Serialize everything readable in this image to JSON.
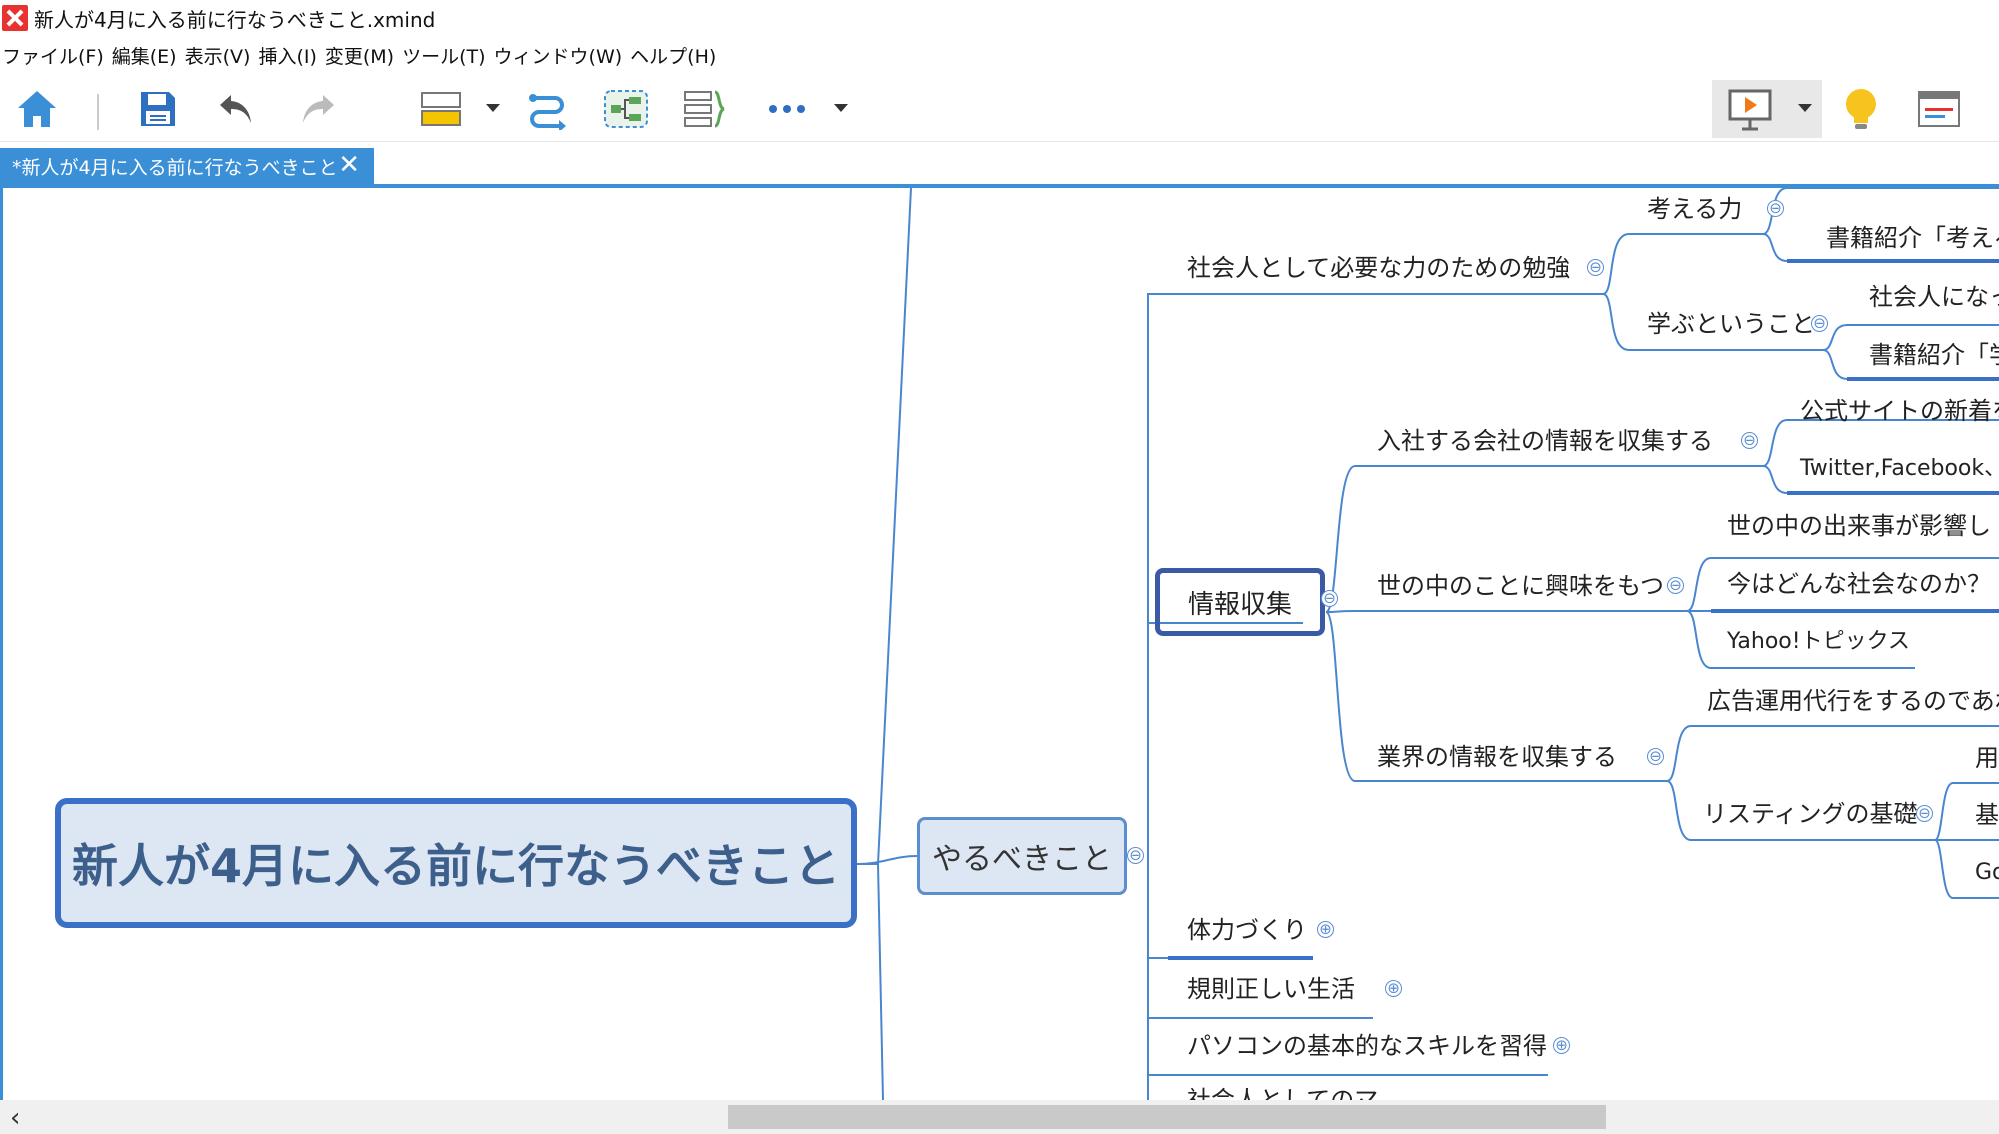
{
  "window": {
    "title": "新人が4月に入る前に行なうべきこと.xmind"
  },
  "menu": [
    "ファイル(F)",
    "編集(E)",
    "表示(V)",
    "挿入(I)",
    "変更(M)",
    "ツール(T)",
    "ウィンドウ(W)",
    "ヘルプ(H)"
  ],
  "toolbar": {
    "icons": [
      "home-icon",
      "save-icon",
      "undo-icon",
      "redo-icon",
      "topic-icon",
      "relationship-icon",
      "boundary-icon",
      "summary-icon",
      "more-icon",
      "presentation-icon",
      "idea-icon",
      "panel-icon"
    ],
    "accent": "#3a8fd6"
  },
  "tab": {
    "label": "*新人が4月に入る前に行なうべきこと",
    "close": "✕"
  },
  "mindmap": {
    "central": "新人が4月に入る前に行なうべきこと",
    "main_topic": "やるべきこと",
    "study": "社会人として必要な力のための勉強",
    "think": "考える力",
    "book_think": "書籍紹介「考える",
    "learn": "学ぶということ",
    "become": "社会人になっ",
    "book_learn": "書籍紹介「学",
    "info": "情報収集",
    "company": "入社する会社の情報を収集する",
    "official": "公式サイトの新着を",
    "twitter": "Twitter,Facebook、",
    "world": "世の中のことに興味をもつ",
    "events": "世の中の出来事が影響し",
    "society": "今はどんな社会なのか？",
    "yahoo": "Yahoo!トピックス",
    "industry": "業界の情報を収集する",
    "ad": "広告運用代行をするのであれ",
    "listing": "リスティングの基礎",
    "yo": "用",
    "ki": "基",
    "go": "Go",
    "fitness": "体力づくり",
    "regular": "規則正しい生活",
    "pc": "パソコンの基本的なスキルを習得",
    "cut": "社会人としてのマ"
  },
  "colors": {
    "line": "#4a86cf",
    "central_border": "#3a70c6",
    "selected": "#3a5aa6"
  }
}
